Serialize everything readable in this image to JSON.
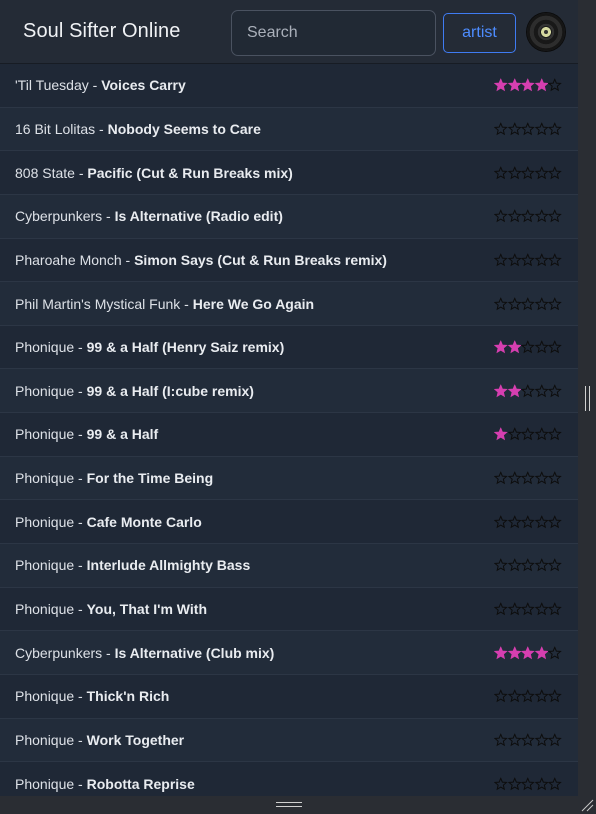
{
  "app": {
    "title": "Soul Sifter Online"
  },
  "search": {
    "placeholder": "Search",
    "value": ""
  },
  "filter": {
    "label": "artist"
  },
  "colors": {
    "rated_star": "#d63fb0",
    "empty_star_stroke": "#0d0d0d",
    "accent": "#4d8cff"
  },
  "max_rating": 5,
  "songs": [
    {
      "artist": "'Til Tuesday",
      "separator": " - ",
      "title": "Voices Carry",
      "rating": 4
    },
    {
      "artist": "16 Bit Lolitas",
      "separator": " - ",
      "title": "Nobody Seems to Care",
      "rating": 0
    },
    {
      "artist": "808 State",
      "separator": " - ",
      "title": "Pacific (Cut & Run Breaks mix)",
      "rating": 0
    },
    {
      "artist": "Cyberpunkers",
      "separator": " - ",
      "title": "Is Alternative (Radio edit)",
      "rating": 0
    },
    {
      "artist": "Pharoahe Monch",
      "separator": " - ",
      "title": "Simon Says (Cut & Run Breaks remix)",
      "rating": 0
    },
    {
      "artist": "Phil Martin's Mystical Funk",
      "separator": " - ",
      "title": "Here We Go Again",
      "rating": 0
    },
    {
      "artist": "Phonique",
      "separator": " - ",
      "title": "99 & a Half (Henry Saiz remix)",
      "rating": 2
    },
    {
      "artist": "Phonique",
      "separator": " - ",
      "title": "99 & a Half (I:cube remix)",
      "rating": 2
    },
    {
      "artist": "Phonique",
      "separator": " - ",
      "title": "99 & a Half",
      "rating": 1
    },
    {
      "artist": "Phonique",
      "separator": " - ",
      "title": "For the Time Being",
      "rating": 0
    },
    {
      "artist": "Phonique",
      "separator": " - ",
      "title": "Cafe Monte Carlo",
      "rating": 0
    },
    {
      "artist": "Phonique",
      "separator": " - ",
      "title": "Interlude Allmighty Bass",
      "rating": 0
    },
    {
      "artist": "Phonique",
      "separator": " - ",
      "title": "You, That I'm With",
      "rating": 0
    },
    {
      "artist": "Cyberpunkers",
      "separator": " - ",
      "title": "Is Alternative (Club mix)",
      "rating": 4
    },
    {
      "artist": "Phonique",
      "separator": " - ",
      "title": "Thick'n Rich",
      "rating": 0
    },
    {
      "artist": "Phonique",
      "separator": " - ",
      "title": "Work Together",
      "rating": 0
    },
    {
      "artist": "Phonique",
      "separator": " - ",
      "title": "Robotta Reprise",
      "rating": 0
    }
  ]
}
